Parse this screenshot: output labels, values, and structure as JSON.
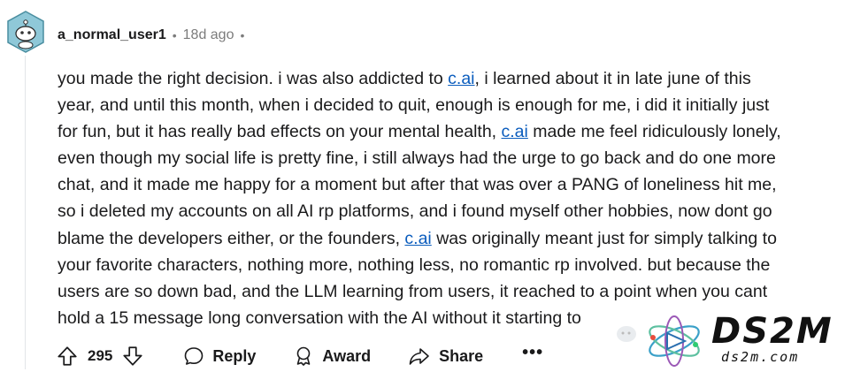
{
  "comment": {
    "username": "a_normal_user1",
    "separator": "•",
    "time": "18d ago",
    "trailing_dot": "•",
    "lines": [
      [
        {
          "t": "you made the right decision. i was also addicted to "
        },
        {
          "t": "c.ai",
          "link": true
        },
        {
          "t": ", i learned about it in late june of this"
        }
      ],
      [
        {
          "t": "year, and until this month, when i decided to quit, enough is enough for me, i did it initially just"
        }
      ],
      [
        {
          "t": "for fun, but it has really bad effects on your mental health, "
        },
        {
          "t": "c.ai",
          "link": true
        },
        {
          "t": " made me feel ridiculously lonely,"
        }
      ],
      [
        {
          "t": "even though my social life is pretty fine, i still always had the urge to go back and do one more"
        }
      ],
      [
        {
          "t": "chat, and it made me happy for a moment but after that was over a PANG of loneliness hit me,"
        }
      ],
      [
        {
          "t": "so i deleted my accounts on all AI rp platforms, and i found myself other hobbies, now dont go"
        }
      ],
      [
        {
          "t": "blame the developers either, or the founders, "
        },
        {
          "t": "c.ai",
          "link": true
        },
        {
          "t": " was originally meant just for simply talking to"
        }
      ],
      [
        {
          "t": "your favorite characters, nothing more, nothing less, no romantic rp involved. but because the"
        }
      ],
      [
        {
          "t": "users are so down bad, and the LLM learning from users, it reached to a point when you cant"
        }
      ],
      [
        {
          "t": "hold a 15 message long conversation with the AI without it starting to"
        }
      ]
    ]
  },
  "actions": {
    "vote_count": "295",
    "reply_label": "Reply",
    "award_label": "Award",
    "share_label": "Share",
    "more_label": "•••"
  },
  "watermark": {
    "title": "DS2M",
    "subtitle": "ds2m.com"
  },
  "icons": [
    "upvote-icon",
    "downvote-icon",
    "reply-icon",
    "award-icon",
    "share-icon",
    "more-icon",
    "avatar-icon"
  ],
  "colors": {
    "link": "#0a5cbd",
    "meta": "#7c7c7c",
    "text": "#1a1a1b"
  }
}
